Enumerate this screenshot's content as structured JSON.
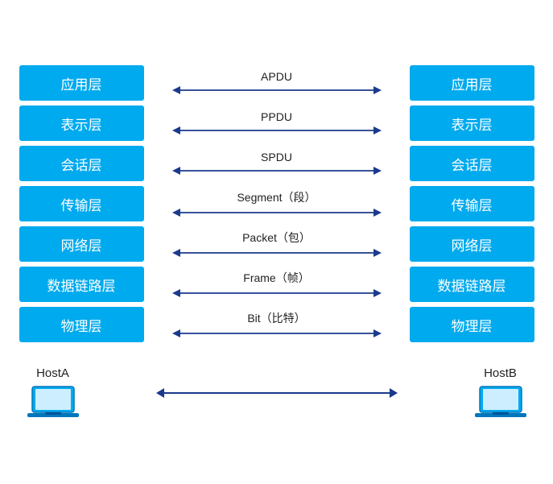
{
  "layers": [
    {
      "left": "应用层",
      "right": "应用层",
      "label": "APDU",
      "id": "application"
    },
    {
      "left": "表示层",
      "right": "表示层",
      "label": "PPDU",
      "id": "presentation"
    },
    {
      "left": "会话层",
      "right": "会话层",
      "label": "SPDU",
      "id": "session"
    },
    {
      "left": "传输层",
      "right": "传输层",
      "label": "Segment（段）",
      "id": "transport"
    },
    {
      "left": "网络层",
      "right": "网络层",
      "label": "Packet（包）",
      "id": "network"
    },
    {
      "left": "数据链路层",
      "right": "数据链路层",
      "label": "Frame（帧）",
      "id": "datalink"
    },
    {
      "left": "物理层",
      "right": "物理层",
      "label": "Bit（比特）",
      "id": "physical"
    }
  ],
  "hosts": {
    "left": "HostA",
    "right": "HostB"
  },
  "colors": {
    "box_bg": "#00aaee",
    "box_text": "#ffffff",
    "arrow": "#1a3a8c",
    "label": "#222222"
  }
}
